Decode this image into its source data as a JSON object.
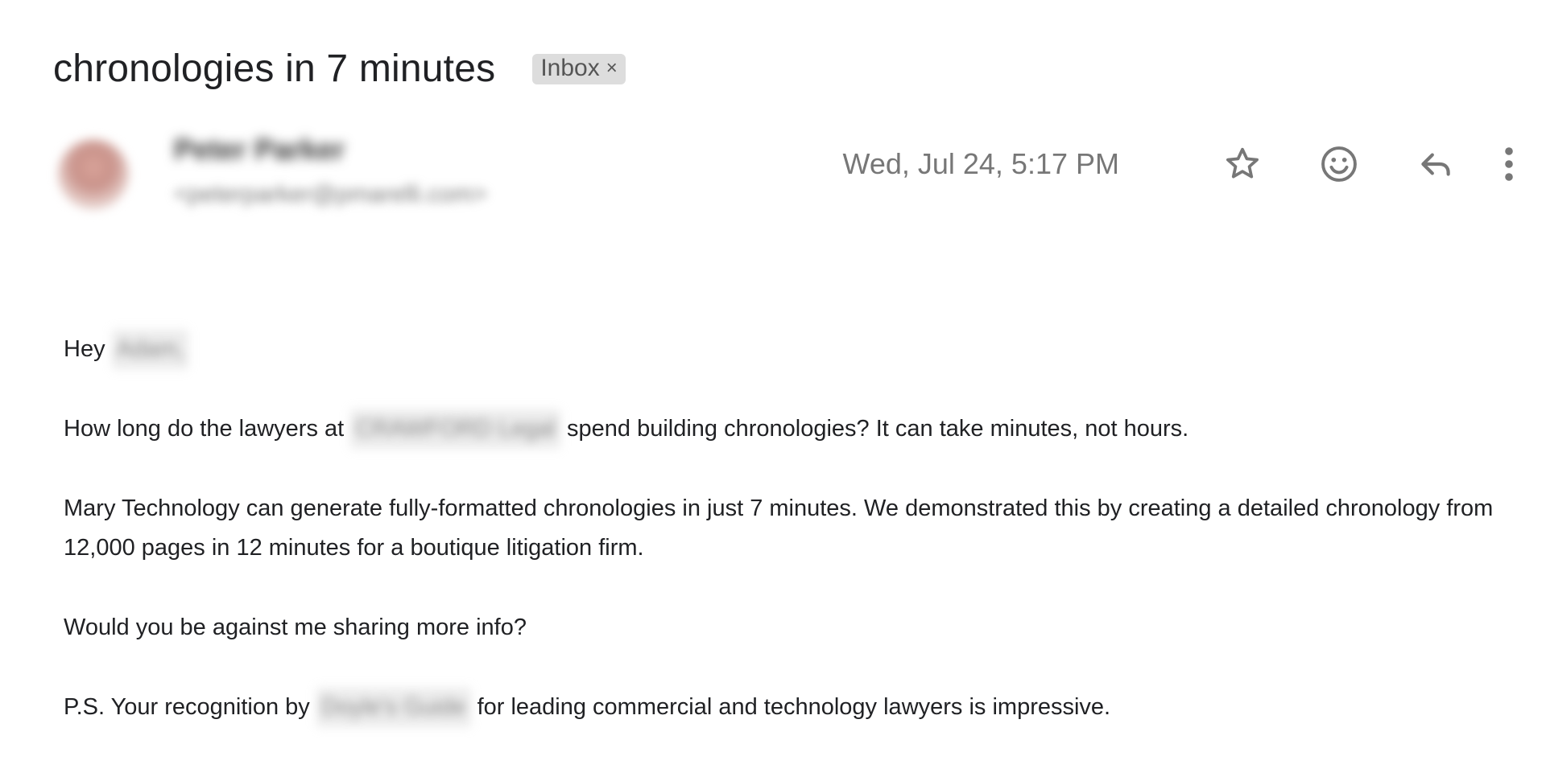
{
  "subject": "chronologies in 7 minutes",
  "label": {
    "text": "Inbox",
    "close_glyph": "×"
  },
  "sender": {
    "name": "Peter Parker",
    "email": "<peterparker@pmarelli.com>",
    "avatar_icon": "avatar"
  },
  "date": "Wed, Jul 24, 5:17 PM",
  "actions": [
    {
      "name": "star-icon"
    },
    {
      "name": "emoji-icon"
    },
    {
      "name": "reply-icon"
    },
    {
      "name": "more-vert-icon"
    }
  ],
  "message": {
    "greeting_prefix": "Hey",
    "greeting_name": "Adam,",
    "p1_before": "How long do the lawyers at",
    "p1_redacted": "CRAWFORD Legal",
    "p1_after": "spend building chronologies? It can take minutes, not hours.",
    "p2": "Mary Technology can generate fully-formatted chronologies in just 7 minutes. We demonstrated this by creating a detailed chronology from 12,000 pages in 12 minutes for a boutique litigation firm.",
    "p3": "Would you be against me sharing more info?",
    "p4_before": "P.S. Your recognition by",
    "p4_redacted": "Doyle's Guide",
    "p4_after": "for leading commercial and technology lawyers is impressive."
  },
  "colors": {
    "text": "#202124",
    "muted": "#777777",
    "chip_bg": "#dddddd",
    "icon": "#777777"
  }
}
